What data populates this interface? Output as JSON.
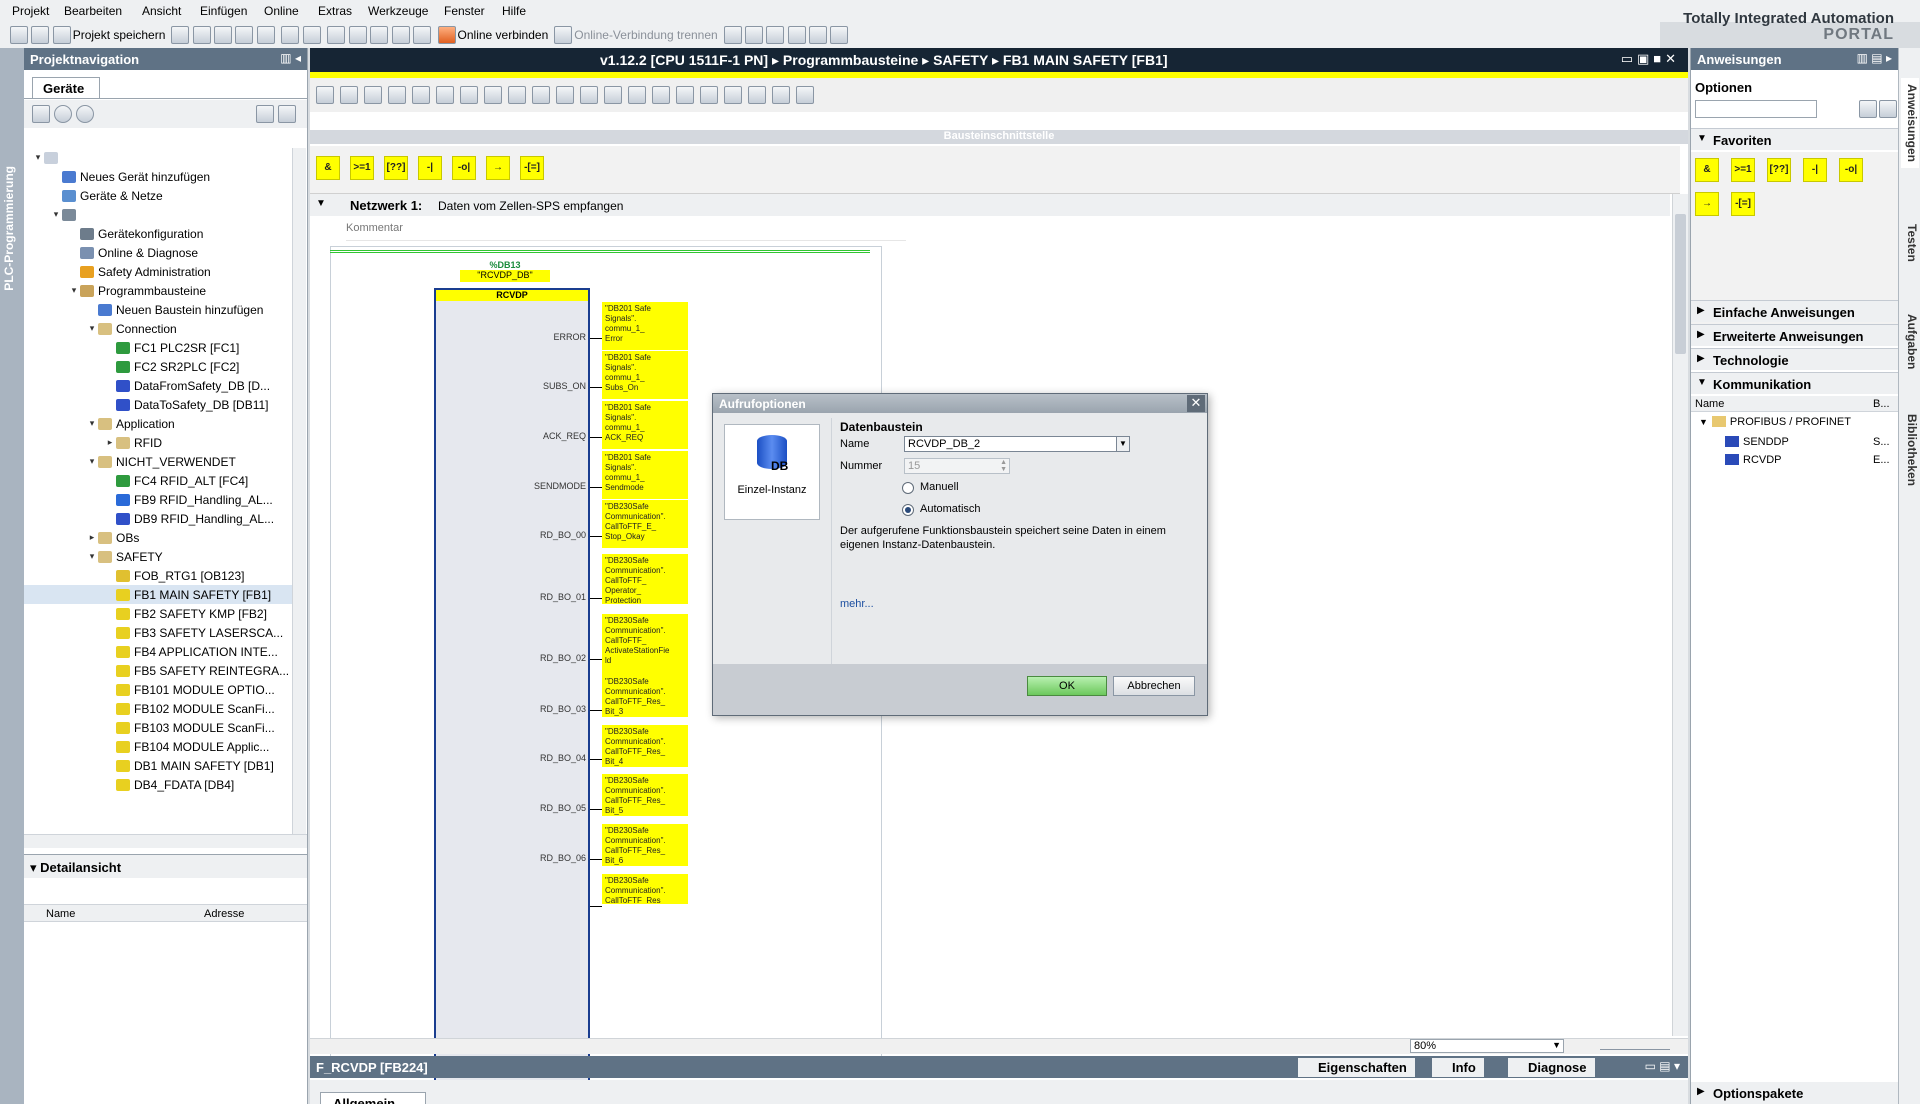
{
  "menu": [
    "Projekt",
    "Bearbeiten",
    "Ansicht",
    "Einfügen",
    "Online",
    "Extras",
    "Werkzeuge",
    "Fenster",
    "Hilfe"
  ],
  "brand": {
    "title": "Totally Integrated Automation",
    "portal": "PORTAL"
  },
  "toolbar": {
    "save": "Projekt speichern",
    "online": "Online verbinden",
    "offline": "Online-Verbindung trennen"
  },
  "left_tab": "PLC-Programmierung",
  "projnav": {
    "title": "Projektnavigation",
    "devices_tab": "Geräte",
    "tree": [
      {
        "label": "",
        "lvl": 0,
        "tw": "▾",
        "color": "#c8d0dc"
      },
      {
        "label": "Neues Gerät hinzufügen",
        "lvl": 1,
        "tw": "",
        "color": "#4a7ad0"
      },
      {
        "label": "Geräte & Netze",
        "lvl": 1,
        "tw": "",
        "color": "#5a8fd0"
      },
      {
        "label": "",
        "lvl": 1,
        "tw": "▾",
        "color": "#7b8a99"
      },
      {
        "label": "Gerätekonfiguration",
        "lvl": 2,
        "tw": "",
        "color": "#6d7c8b"
      },
      {
        "label": "Online & Diagnose",
        "lvl": 2,
        "tw": "",
        "color": "#7a90b0"
      },
      {
        "label": "Safety Administration",
        "lvl": 2,
        "tw": "",
        "color": "#e8a020"
      },
      {
        "label": "Programmbausteine",
        "lvl": 2,
        "tw": "▾",
        "color": "#c9a35a"
      },
      {
        "label": "Neuen Baustein hinzufügen",
        "lvl": 3,
        "tw": "",
        "color": "#4a7ad0"
      },
      {
        "label": "Connection",
        "lvl": 3,
        "tw": "▾",
        "color": "#d8c080"
      },
      {
        "label": "FC1 PLC2SR [FC1]",
        "lvl": 4,
        "tw": "",
        "color": "#2e9a3e"
      },
      {
        "label": "FC2 SR2PLC [FC2]",
        "lvl": 4,
        "tw": "",
        "color": "#2e9a3e"
      },
      {
        "label": "DataFromSafety_DB [D...",
        "lvl": 4,
        "tw": "",
        "color": "#3050c8"
      },
      {
        "label": "DataToSafety_DB [DB11]",
        "lvl": 4,
        "tw": "",
        "color": "#3050c8"
      },
      {
        "label": "Application",
        "lvl": 3,
        "tw": "▾",
        "color": "#d8c080"
      },
      {
        "label": "RFID",
        "lvl": 4,
        "tw": "▸",
        "color": "#d8c080"
      },
      {
        "label": "NICHT_VERWENDET",
        "lvl": 3,
        "tw": "▾",
        "color": "#d8c080"
      },
      {
        "label": "FC4 RFID_ALT [FC4]",
        "lvl": 4,
        "tw": "",
        "color": "#2e9a3e"
      },
      {
        "label": "FB9 RFID_Handling_AL...",
        "lvl": 4,
        "tw": "",
        "color": "#2a6ad8"
      },
      {
        "label": "DB9 RFID_Handling_AL...",
        "lvl": 4,
        "tw": "",
        "color": "#3050c8"
      },
      {
        "label": "OBs",
        "lvl": 3,
        "tw": "▸",
        "color": "#d8c080"
      },
      {
        "label": "SAFETY",
        "lvl": 3,
        "tw": "▾",
        "color": "#d8c080"
      },
      {
        "label": "FOB_RTG1 [OB123]",
        "lvl": 4,
        "tw": "",
        "color": "#e0c030"
      },
      {
        "label": "FB1 MAIN SAFETY [FB1]",
        "lvl": 4,
        "tw": "",
        "color": "#e8d020",
        "sel": true
      },
      {
        "label": "FB2 SAFETY KMP [FB2]",
        "lvl": 4,
        "tw": "",
        "color": "#e8d020"
      },
      {
        "label": "FB3 SAFETY LASERSCA...",
        "lvl": 4,
        "tw": "",
        "color": "#e8d020"
      },
      {
        "label": "FB4 APPLICATION INTE...",
        "lvl": 4,
        "tw": "",
        "color": "#e8d020"
      },
      {
        "label": "FB5 SAFETY REINTEGRA...",
        "lvl": 4,
        "tw": "",
        "color": "#e8d020"
      },
      {
        "label": "FB101 MODULE OPTIO...",
        "lvl": 4,
        "tw": "",
        "color": "#e8d020"
      },
      {
        "label": "FB102 MODULE ScanFi...",
        "lvl": 4,
        "tw": "",
        "color": "#e8d020"
      },
      {
        "label": "FB103 MODULE ScanFi...",
        "lvl": 4,
        "tw": "",
        "color": "#e8d020"
      },
      {
        "label": "FB104 MODULE Applic...",
        "lvl": 4,
        "tw": "",
        "color": "#e8d020"
      },
      {
        "label": "DB1 MAIN SAFETY [DB1]",
        "lvl": 4,
        "tw": "",
        "color": "#e8d020"
      },
      {
        "label": "DB4_FDATA [DB4]",
        "lvl": 4,
        "tw": "",
        "color": "#e8d020"
      }
    ],
    "detail_title": "Detailansicht",
    "detail_cols": [
      "Name",
      "Adresse"
    ]
  },
  "editor": {
    "breadcrumb": [
      "v1.12.2 [CPU 1511F-1 PN]",
      "Programmbausteine",
      "SAFETY",
      "FB1 MAIN SAFETY [FB1]"
    ],
    "interface_bar": "Bausteinschnittstelle",
    "fav_buttons": [
      "&",
      ">=1",
      "[??]",
      "-|",
      "-o|",
      "→",
      "-[=]"
    ],
    "network_label": "Netzwerk 1:",
    "network_title": "Daten vom Zellen-SPS empfangen",
    "comment_placeholder": "Kommentar",
    "db_address": "%DB13",
    "db_name": "\"RCVDP_DB\"",
    "fb_name": "RCVDP",
    "pins": [
      {
        "name": "ERROR",
        "sig": "\"DB201 Safe\nSignals\".\ncommu_1_\nError"
      },
      {
        "name": "SUBS_ON",
        "sig": "\"DB201 Safe\nSignals\".\ncommu_1_\nSubs_On"
      },
      {
        "name": "ACK_REQ",
        "sig": "\"DB201 Safe\nSignals\".\ncommu_1_\nACK_REQ"
      },
      {
        "name": "SENDMODE",
        "sig": "\"DB201 Safe\nSignals\".\ncommu_1_\nSendmode"
      },
      {
        "name": "RD_BO_00",
        "sig": "\"DB230Safe\nCommunication\".\nCallToFTF_E_\nStop_Okay"
      },
      {
        "name": "RD_BO_01",
        "sig": "\"DB230Safe\nCommunication\".\nCallToFTF_\nOperator_\nProtection"
      },
      {
        "name": "RD_BO_02",
        "sig": "\"DB230Safe\nCommunication\".\nCallToFTF_\nActivateStationFie\nld"
      },
      {
        "name": "RD_BO_03",
        "sig": "\"DB230Safe\nCommunication\".\nCallToFTF_Res_\nBit_3"
      },
      {
        "name": "RD_BO_04",
        "sig": "\"DB230Safe\nCommunication\".\nCallToFTF_Res_\nBit_4"
      },
      {
        "name": "RD_BO_05",
        "sig": "\"DB230Safe\nCommunication\".\nCallToFTF_Res_\nBit_5"
      },
      {
        "name": "RD_BO_06",
        "sig": "\"DB230Safe\nCommunication\".\nCallToFTF_Res_\nBit_6"
      },
      {
        "name": "",
        "sig": "\"DB230Safe\nCommunication\".\nCallToFTF_Res_"
      }
    ],
    "zoom": "80%",
    "inspector_left": "F_RCVDP [FB224]",
    "inspector_tabs": [
      "Eigenschaften",
      "Info",
      "Diagnose"
    ],
    "inspector_subtab": "Allgemein"
  },
  "instructions": {
    "title": "Anweisungen",
    "options_label": "Optionen",
    "sections": [
      "Favoriten",
      "Einfache Anweisungen",
      "Erweiterte Anweisungen",
      "Technologie",
      "Kommunikation"
    ],
    "fav_buttons": [
      "&",
      ">=1",
      "[??]",
      "-|",
      "-o|",
      "→",
      "-[=]"
    ],
    "cols": [
      "Name",
      "B..."
    ],
    "comm_tree": [
      {
        "label": "PROFIBUS / PROFINET",
        "extra": ""
      },
      {
        "label": "SENDDP",
        "extra": "S..."
      },
      {
        "label": "RCVDP",
        "extra": "E..."
      }
    ],
    "option_packs": "Optionspakete"
  },
  "right_tabs": [
    "Anweisungen",
    "Testen",
    "Aufgaben",
    "Bibliotheken"
  ],
  "dialog": {
    "title": "Aufrufoptionen",
    "instance_label": "Einzel-Instanz",
    "section": "Datenbaustein",
    "name_label": "Name",
    "name_value": "RCVDP_DB_2",
    "number_label": "Nummer",
    "number_value": "15",
    "radio_manual": "Manuell",
    "radio_auto": "Automatisch",
    "description": "Der aufgerufene Funktionsbaustein speichert seine Daten in einem eigenen Instanz-Datenbaustein.",
    "more": "mehr...",
    "ok": "OK",
    "cancel": "Abbrechen"
  }
}
